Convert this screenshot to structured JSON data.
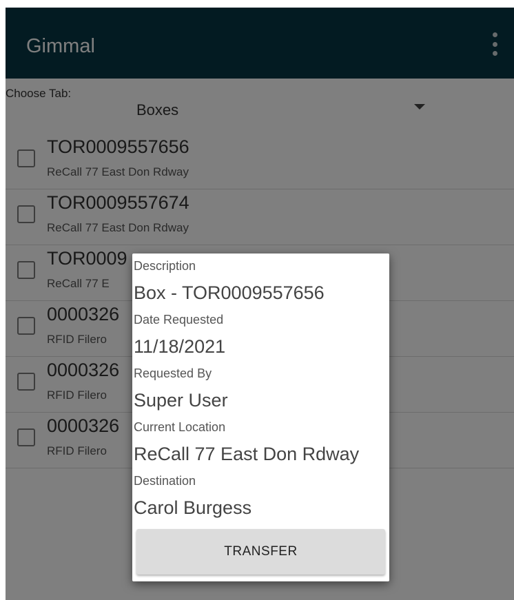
{
  "appbar": {
    "title": "Gimmal",
    "menu_icon": "overflow-menu-icon"
  },
  "tab_selector": {
    "label": "Choose Tab:",
    "value": "Boxes"
  },
  "list": [
    {
      "id": "TOR0009557656",
      "location": "ReCall 77 East Don Rdway"
    },
    {
      "id": "TOR0009557674",
      "location": "ReCall 77 East Don Rdway"
    },
    {
      "id": "TOR0009",
      "location": "ReCall 77 E"
    },
    {
      "id": "0000326",
      "location": "RFID Filero"
    },
    {
      "id": "0000326",
      "location": "RFID Filero"
    },
    {
      "id": "0000326",
      "location": "RFID Filero"
    }
  ],
  "dialog": {
    "description_label": "Description",
    "description_value": "Box - TOR0009557656",
    "date_label": "Date Requested",
    "date_value": "11/18/2021",
    "requested_by_label": "Requested By",
    "requested_by_value": "Super User",
    "current_location_label": "Current Location",
    "current_location_value": "ReCall 77 East Don Rdway",
    "destination_label": "Destination",
    "destination_value": "Carol Burgess",
    "transfer_button": "TRANSFER"
  }
}
